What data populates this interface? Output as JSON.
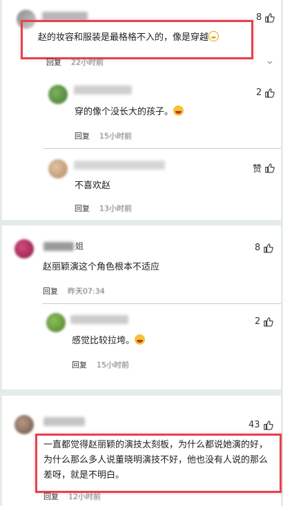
{
  "comments": [
    {
      "text": "赵的妆容和服装是最格格不入的，像是穿越",
      "likes": "8",
      "reply_label": "回复",
      "time": "22小时前",
      "replies": [
        {
          "text": "穿的像个没长大的孩子。",
          "likes": "2",
          "reply_label": "回复",
          "time": "15小时前"
        },
        {
          "text": "不喜欢赵",
          "likes": "赞",
          "reply_label": "回复",
          "time": "13小时前"
        }
      ]
    },
    {
      "name_suffix": "姐",
      "text": "赵丽颖演这个角色根本不适应",
      "likes": "8",
      "reply_label": "回复",
      "time": "昨天07:34",
      "replies": [
        {
          "text": "感觉比较拉垮。",
          "likes": "2",
          "reply_label": "回复",
          "time": "15小时前"
        }
      ]
    },
    {
      "text": "一直都觉得赵丽颖的演技太刻板，为什么都说她演的好，为什么那么多人说董晓明演技不好，他也没有人说的那么差呀，就是不明白。",
      "likes": "43",
      "reply_label": "回复",
      "time": "12小时前"
    }
  ],
  "colors": {
    "highlight": "#e5414f",
    "background": "#e3ece6"
  },
  "icons": {
    "like": "thumbs-up-icon",
    "emoji": "emoji-icon"
  }
}
